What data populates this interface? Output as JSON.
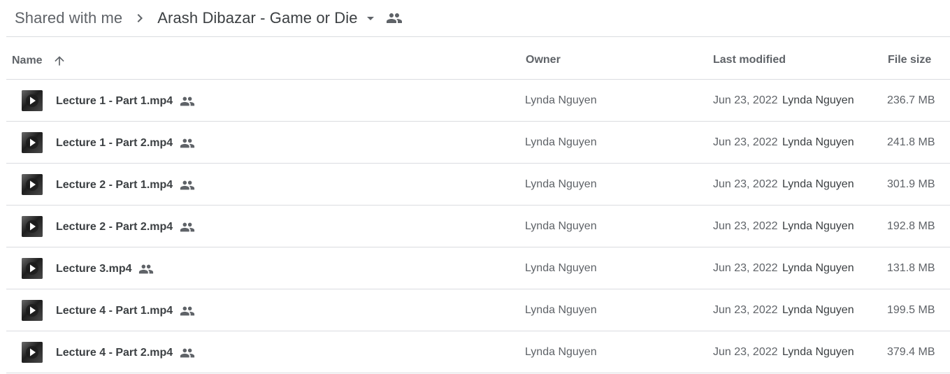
{
  "breadcrumb": {
    "root": "Shared with me",
    "current": "Arash Dibazar - Game or Die",
    "icons": {
      "separator": "chevron-right-icon",
      "dropdown": "arrow-drop-down-icon",
      "shared": "people-icon"
    }
  },
  "table": {
    "columns": {
      "name": "Name",
      "owner": "Owner",
      "last_modified": "Last modified",
      "file_size": "File size"
    },
    "sort": {
      "column": "name",
      "direction": "ascending",
      "icon": "arrow-up-icon"
    },
    "rows": [
      {
        "name": "Lecture 1 - Part 1.mp4",
        "owner": "Lynda Nguyen",
        "modified_date": "Jun 23, 2022",
        "modified_by": "Lynda Nguyen",
        "size": "236.7 MB"
      },
      {
        "name": "Lecture 1 - Part 2.mp4",
        "owner": "Lynda Nguyen",
        "modified_date": "Jun 23, 2022",
        "modified_by": "Lynda Nguyen",
        "size": "241.8 MB"
      },
      {
        "name": "Lecture 2 - Part 1.mp4",
        "owner": "Lynda Nguyen",
        "modified_date": "Jun 23, 2022",
        "modified_by": "Lynda Nguyen",
        "size": "301.9 MB"
      },
      {
        "name": "Lecture 2 - Part 2.mp4",
        "owner": "Lynda Nguyen",
        "modified_date": "Jun 23, 2022",
        "modified_by": "Lynda Nguyen",
        "size": "192.8 MB"
      },
      {
        "name": "Lecture 3.mp4",
        "owner": "Lynda Nguyen",
        "modified_date": "Jun 23, 2022",
        "modified_by": "Lynda Nguyen",
        "size": "131.8 MB"
      },
      {
        "name": "Lecture 4 - Part 1.mp4",
        "owner": "Lynda Nguyen",
        "modified_date": "Jun 23, 2022",
        "modified_by": "Lynda Nguyen",
        "size": "199.5 MB"
      },
      {
        "name": "Lecture 4 - Part 2.mp4",
        "owner": "Lynda Nguyen",
        "modified_date": "Jun 23, 2022",
        "modified_by": "Lynda Nguyen",
        "size": "379.4 MB"
      }
    ]
  },
  "colors": {
    "text_primary": "#3c4043",
    "text_secondary": "#5f6368",
    "divider": "#dadce0"
  }
}
